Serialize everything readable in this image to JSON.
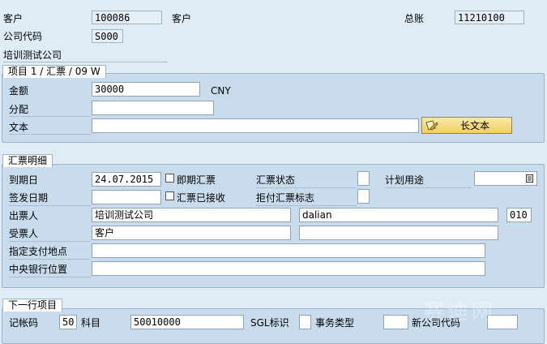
{
  "header": {
    "customer_label": "客户",
    "customer_value": "100086",
    "customer_label2": "客户",
    "gl_label": "总账",
    "gl_value": "11210100",
    "company_code_label": "公司代码",
    "company_code_value": "S000",
    "company_name": "培训测试公司"
  },
  "item_group": {
    "title": "项目 1 / 汇票 / 09 W",
    "amount_label": "金额",
    "amount_value": "30000",
    "currency": "CNY",
    "assignment_label": "分配",
    "assignment_value": "",
    "text_label": "文本",
    "text_value": "",
    "long_text_button": "长文本"
  },
  "bill_group": {
    "title": "汇票明细",
    "due_date_label": "到期日",
    "due_date_value": "24.07.2015",
    "demand_bill_label": "即期汇票",
    "bill_status_label": "汇票状态",
    "planned_use_label": "计划用途",
    "issue_date_label": "签发日期",
    "accepted_label": "汇票已接收",
    "protest_label": "拒付汇票标志",
    "drawer_label": "出票人",
    "drawer_name": "培训测试公司",
    "drawer_city": "dalian",
    "drawer_code": "010",
    "drawee_label": "受票人",
    "drawee_name": "客户",
    "payment_place_label": "指定支付地点",
    "central_bank_label": "中央银行位置"
  },
  "next_group": {
    "title": "下一行项目",
    "posting_key_label": "记帐码",
    "posting_key_value": "50",
    "account_label": "科目",
    "account_value": "50010000",
    "sgl_label": "SGL标识",
    "trans_type_label": "事务类型",
    "new_company_label": "新公司代码"
  },
  "watermark": "赛迪网"
}
